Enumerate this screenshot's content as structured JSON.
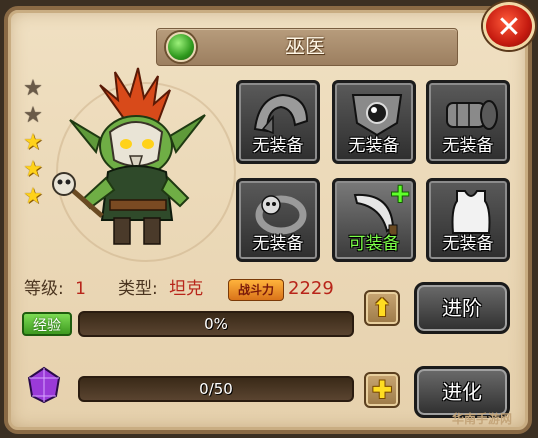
{
  "window": {
    "title": "巫医",
    "close_glyph": "✕"
  },
  "hero": {
    "stars_total": 5,
    "stars_filled": 3
  },
  "equipment_slots": [
    {
      "label": "无装备",
      "icon": "shoulder-armor-icon",
      "state": "empty"
    },
    {
      "label": "无装备",
      "icon": "amulet-icon",
      "state": "empty"
    },
    {
      "label": "无装备",
      "icon": "gauntlet-icon",
      "state": "empty"
    },
    {
      "label": "无装备",
      "icon": "skull-ring-icon",
      "state": "empty"
    },
    {
      "label": "可装备",
      "icon": "curved-blade-icon",
      "state": "equippable"
    },
    {
      "label": "无装备",
      "icon": "vest-icon",
      "state": "empty"
    }
  ],
  "stats": {
    "level_label": "等级:",
    "level_value": "1",
    "type_label": "类型:",
    "type_value": "坦克",
    "power_label": "战斗力",
    "power_value": "2229"
  },
  "experience": {
    "tag": "经验",
    "text": "0%",
    "progress": 0
  },
  "shards": {
    "text": "0/50",
    "current": 0,
    "max": 50
  },
  "buttons": {
    "level_up_glyph": "⬆",
    "advance_label": "进阶",
    "add_glyph": "✚",
    "evolve_label": "进化"
  },
  "watermark": "华南手游网",
  "colors": {
    "accent_red": "#b8251a",
    "gold": "#ffd21a",
    "green": "#5fff2a"
  }
}
